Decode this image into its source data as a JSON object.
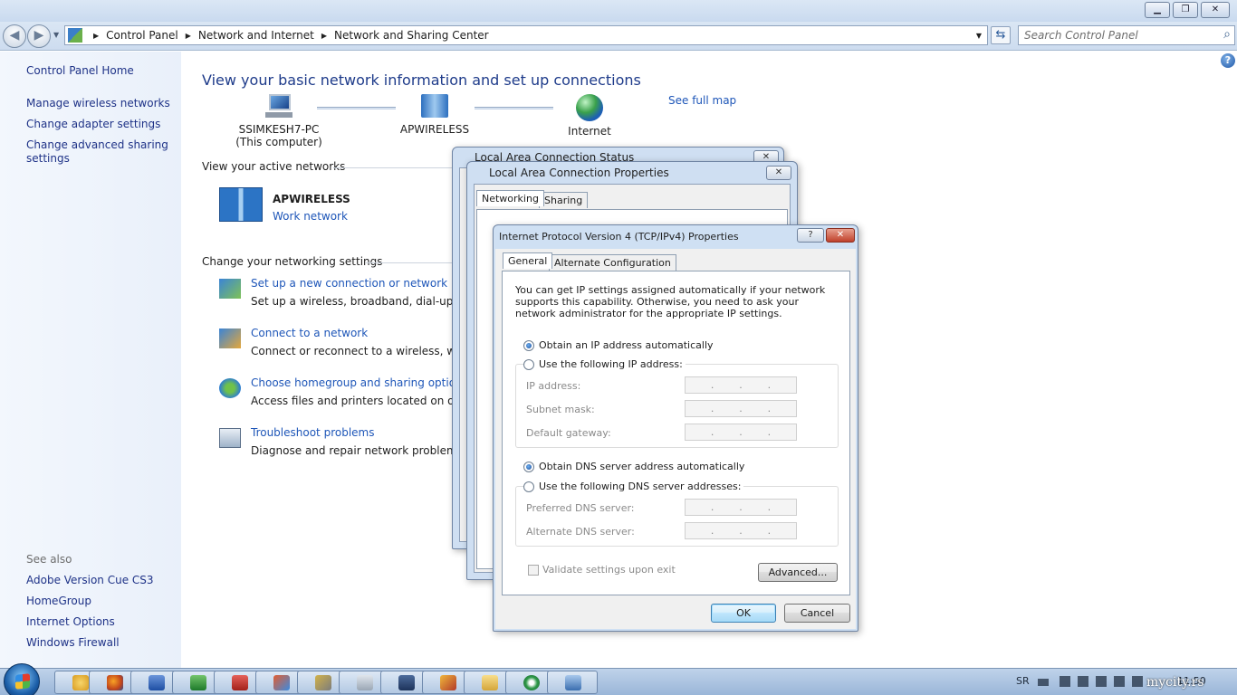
{
  "window": {
    "controls": {
      "minimize": "▁",
      "maximize": "❐",
      "close": "✕"
    }
  },
  "address_bar": {
    "breadcrumbs": [
      "Control Panel",
      "Network and Internet",
      "Network and Sharing Center"
    ],
    "search_placeholder": "Search Control Panel"
  },
  "left_pane": {
    "home": "Control Panel Home",
    "links": [
      "Manage wireless networks",
      "Change adapter settings",
      "Change advanced sharing",
      "settings"
    ],
    "see_also_label": "See also",
    "see_also": [
      "Adobe Version Cue CS3",
      "HomeGroup",
      "Internet Options",
      "Windows Firewall"
    ]
  },
  "main": {
    "heading": "View your basic network information and set up connections",
    "see_full_map": "See full map",
    "map": {
      "computer_name": "SSIMKESH7-PC",
      "computer_sub": "(This computer)",
      "network": "APWIRELESS",
      "internet": "Internet"
    },
    "active_label": "View your active networks",
    "active_network": {
      "name": "APWIRELESS",
      "type": "Work network"
    },
    "settings_label": "Change your networking settings",
    "tasks": [
      {
        "link": "Set up a new connection or network",
        "desc": "Set up a wireless, broadband, dial-up, ad h"
      },
      {
        "link": "Connect to a network",
        "desc": "Connect or reconnect to a wireless, wired,"
      },
      {
        "link": "Choose homegroup and sharing options",
        "desc": "Access files and printers located on other n"
      },
      {
        "link": "Troubleshoot problems",
        "desc": "Diagnose and repair network problems, or"
      }
    ],
    "help": "?"
  },
  "status_dialog": {
    "title": "Local Area Connection Status"
  },
  "properties_dialog": {
    "title": "Local Area Connection Properties",
    "tabs": [
      "Networking",
      "Sharing"
    ]
  },
  "ipv4_dialog": {
    "title": "Internet Protocol Version 4 (TCP/IPv4) Properties",
    "help_btn": "?",
    "tabs": [
      "General",
      "Alternate Configuration"
    ],
    "intro": "You can get IP settings assigned automatically if your network supports this capability. Otherwise, you need to ask your network administrator for the appropriate IP settings.",
    "ip_auto": "Obtain an IP address automatically",
    "ip_manual": "Use the following IP address:",
    "ip_fields": [
      "IP address:",
      "Subnet mask:",
      "Default gateway:"
    ],
    "dns_auto": "Obtain DNS server address automatically",
    "dns_manual": "Use the following DNS server addresses:",
    "dns_fields": [
      "Preferred DNS server:",
      "Alternate DNS server:"
    ],
    "ip_dots": ".",
    "validate": "Validate settings upon exit",
    "advanced": "Advanced...",
    "ok": "OK",
    "cancel": "Cancel"
  },
  "taskbar": {
    "language": "SR",
    "clock": "11:50",
    "watermark": "mycity.rs",
    "app_icons": [
      "windows-explorer-icon",
      "firefox-icon",
      "word-icon",
      "excel-icon",
      "acrobat-icon",
      "tool-icon",
      "tools-icon",
      "calculator-icon",
      "save-icon",
      "archive-icon",
      "folder-icon",
      "browser-icon",
      "control-panel-icon"
    ]
  },
  "colors": {
    "link": "#1e56b8",
    "heading": "#1e3b8a",
    "accent": "#3c7fb1"
  }
}
